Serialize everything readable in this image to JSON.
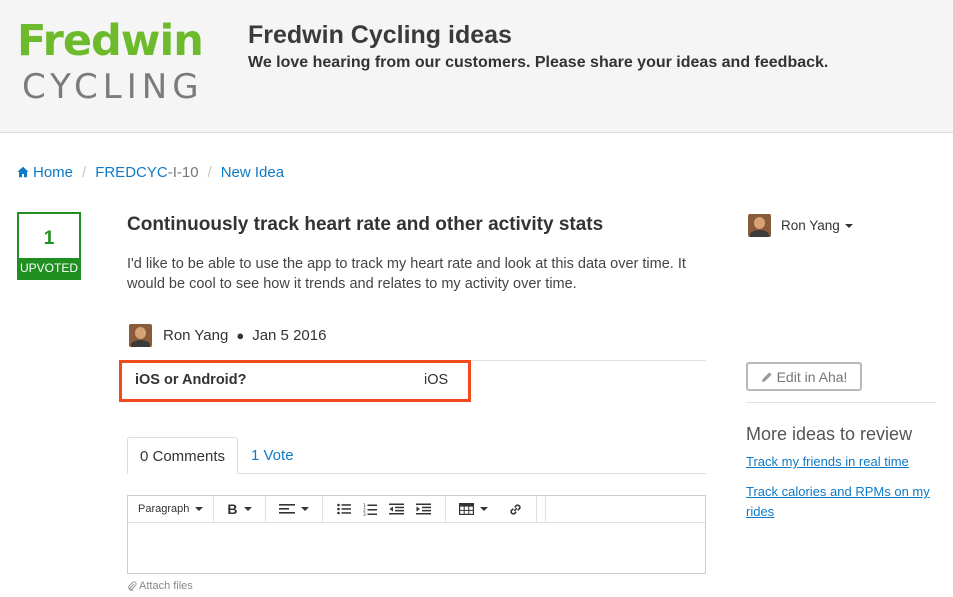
{
  "header": {
    "logo_top": "Fredwin",
    "logo_bottom": "CYCLING",
    "title": "Fredwin Cycling ideas",
    "tagline": "We love hearing from our customers. Please share your ideas and feedback."
  },
  "breadcrumb": {
    "home": "Home",
    "idea_prefix": "FREDCYC",
    "idea_suffix": "-I-10",
    "current": "New Idea"
  },
  "vote": {
    "count": "1",
    "label": "UPVOTED"
  },
  "idea": {
    "title": "Continuously track heart rate and other activity stats",
    "description": "I'd like to be able to use the app to track my heart rate and look at this data over time. It would be cool to see how it trends and relates to my activity over time.",
    "author": "Ron Yang",
    "date": "Jan 5 2016",
    "field_label": "iOS or Android?",
    "field_value": "iOS"
  },
  "tabs": {
    "comments": "0 Comments",
    "votes": "1 Vote"
  },
  "editor": {
    "paragraph_label": "Paragraph",
    "bold_label": "B",
    "attach_label": "Attach files"
  },
  "sidebar": {
    "user_name": "Ron Yang",
    "edit_button": "Edit in Aha!",
    "more_title": "More ideas to review",
    "links": [
      "Track my friends in real time",
      "Track calories and RPMs on my rides"
    ]
  },
  "colors": {
    "brand_green": "#6dbb2c",
    "vote_green": "#1f8f1f",
    "link_blue": "#0f7ac5",
    "highlight_red": "#f04a1d"
  }
}
